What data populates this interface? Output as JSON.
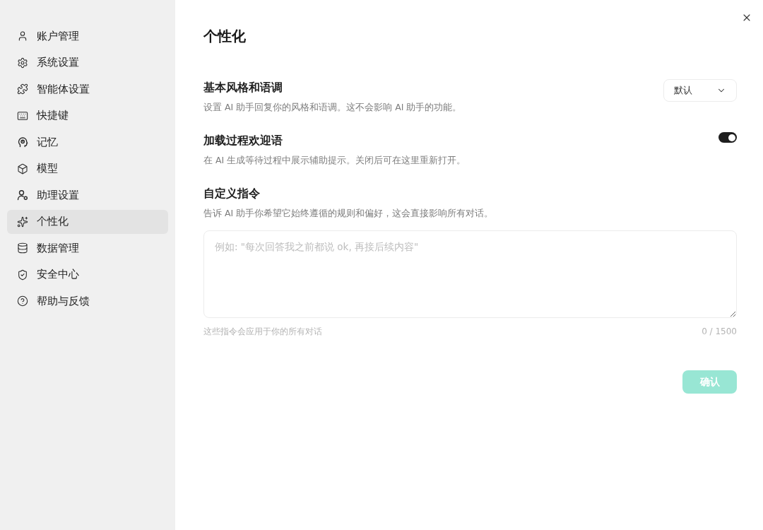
{
  "sidebar": {
    "items": [
      {
        "label": "账户管理",
        "selected": false
      },
      {
        "label": "系统设置",
        "selected": false
      },
      {
        "label": "智能体设置",
        "selected": false
      },
      {
        "label": "快捷键",
        "selected": false
      },
      {
        "label": "记忆",
        "selected": false
      },
      {
        "label": "模型",
        "selected": false
      },
      {
        "label": "助理设置",
        "selected": false
      },
      {
        "label": "个性化",
        "selected": true
      },
      {
        "label": "数据管理",
        "selected": false
      },
      {
        "label": "安全中心",
        "selected": false
      },
      {
        "label": "帮助与反馈",
        "selected": false
      }
    ]
  },
  "page": {
    "title": "个性化",
    "settings": [
      {
        "kind": "select",
        "title": "基本风格和语调",
        "description": "设置 AI 助手回复你的风格和语调。这不会影响 AI 助手的功能。",
        "value": "默认"
      },
      {
        "kind": "toggle",
        "title": "加载过程欢迎语",
        "description": "在 AI 生成等待过程中展示辅助提示。关闭后可在这里重新打开。",
        "on": true
      },
      {
        "kind": "textarea",
        "title": "自定义指令",
        "description": "告诉 AI 助手你希望它始终遵循的规则和偏好，这会直接影响所有对话。",
        "placeholder": "例如: \"每次回答我之前都说 ok, 再接后续内容\"",
        "hint": "这些指令会应用于你的所有对话",
        "counter": "0 / 1500"
      }
    ],
    "confirm_button": {
      "label": "确认",
      "disabled": true
    }
  }
}
